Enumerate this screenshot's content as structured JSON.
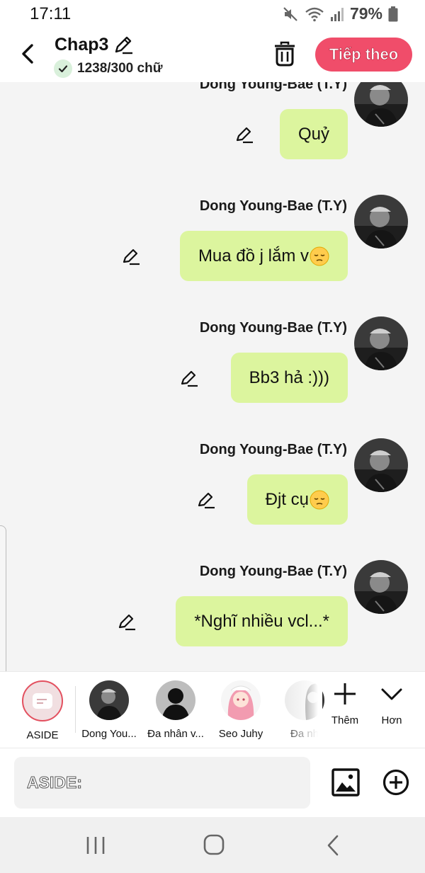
{
  "status_bar": {
    "time": "17:11",
    "battery": "79%"
  },
  "header": {
    "title": "Chap3",
    "word_count": "1238/300 chữ",
    "next_label": "Tiếp theo"
  },
  "messages": [
    {
      "sender": "Dong Young-Bae (T.Y)",
      "text": "Quỷ",
      "emoji": ""
    },
    {
      "sender": "Dong Young-Bae (T.Y)",
      "text": "Mua đồ j lắm v",
      "emoji": "pensive-face"
    },
    {
      "sender": "Dong Young-Bae (T.Y)",
      "text": "Bb3 hả :)))",
      "emoji": ""
    },
    {
      "sender": "Dong Young-Bae (T.Y)",
      "text": "Đjt cụ",
      "emoji": "pensive-face"
    },
    {
      "sender": "Dong Young-Bae (T.Y)",
      "text": "*Nghĩ nhiều vcl...*",
      "emoji": ""
    }
  ],
  "characters": [
    {
      "name": "ASIDE",
      "selected": true
    },
    {
      "name": "Dong You..."
    },
    {
      "name": "Đa nhân v..."
    },
    {
      "name": "Seo Juhy"
    },
    {
      "name": "Đa nh"
    }
  ],
  "strip_actions": {
    "add_label": "Thêm",
    "more_label": "Hơn"
  },
  "input": {
    "placeholder": "ASIDE:",
    "value": ""
  },
  "colors": {
    "accent": "#f04d6a",
    "bubble": "#dcf59e",
    "selected_ring": "#e3505f"
  }
}
